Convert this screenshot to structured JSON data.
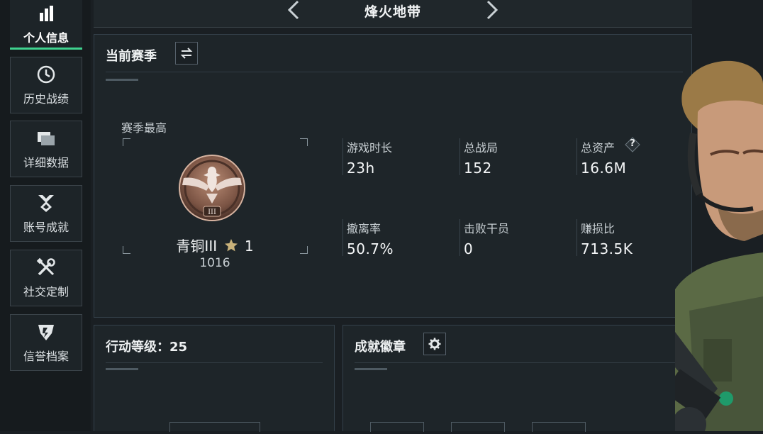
{
  "sidebar": {
    "items": [
      {
        "label": "个人信息",
        "icon": "bar-chart-icon",
        "active": true
      },
      {
        "label": "历史战绩",
        "icon": "clock-icon",
        "active": false
      },
      {
        "label": "详细数据",
        "icon": "folder-icon",
        "active": false
      },
      {
        "label": "账号成就",
        "icon": "achievement-icon",
        "active": false
      },
      {
        "label": "社交定制",
        "icon": "tools-icon",
        "active": false
      },
      {
        "label": "信誉档案",
        "icon": "shield-icon",
        "active": false
      }
    ]
  },
  "header": {
    "title": "烽火地带"
  },
  "season": {
    "title": "当前赛季",
    "best_label": "赛季最高",
    "rank_name": "青铜III",
    "rank_stars": "1",
    "rank_score": "1016",
    "rank_badge_numeral": "III",
    "stats": [
      {
        "label": "游戏时长",
        "value": "23h"
      },
      {
        "label": "总战局",
        "value": "152"
      },
      {
        "label": "总资产",
        "value": "16.6M",
        "help": "?"
      },
      {
        "label": "撤离率",
        "value": "50.7%"
      },
      {
        "label": "击败干员",
        "value": "0"
      },
      {
        "label": "赚损比",
        "value": "713.5K"
      }
    ]
  },
  "action_level": {
    "label": "行动等级：25"
  },
  "badges": {
    "title": "成就徽章"
  },
  "colors": {
    "accent": "#3fd38f",
    "panel": "#1e2529",
    "background": "#1a1f23"
  }
}
